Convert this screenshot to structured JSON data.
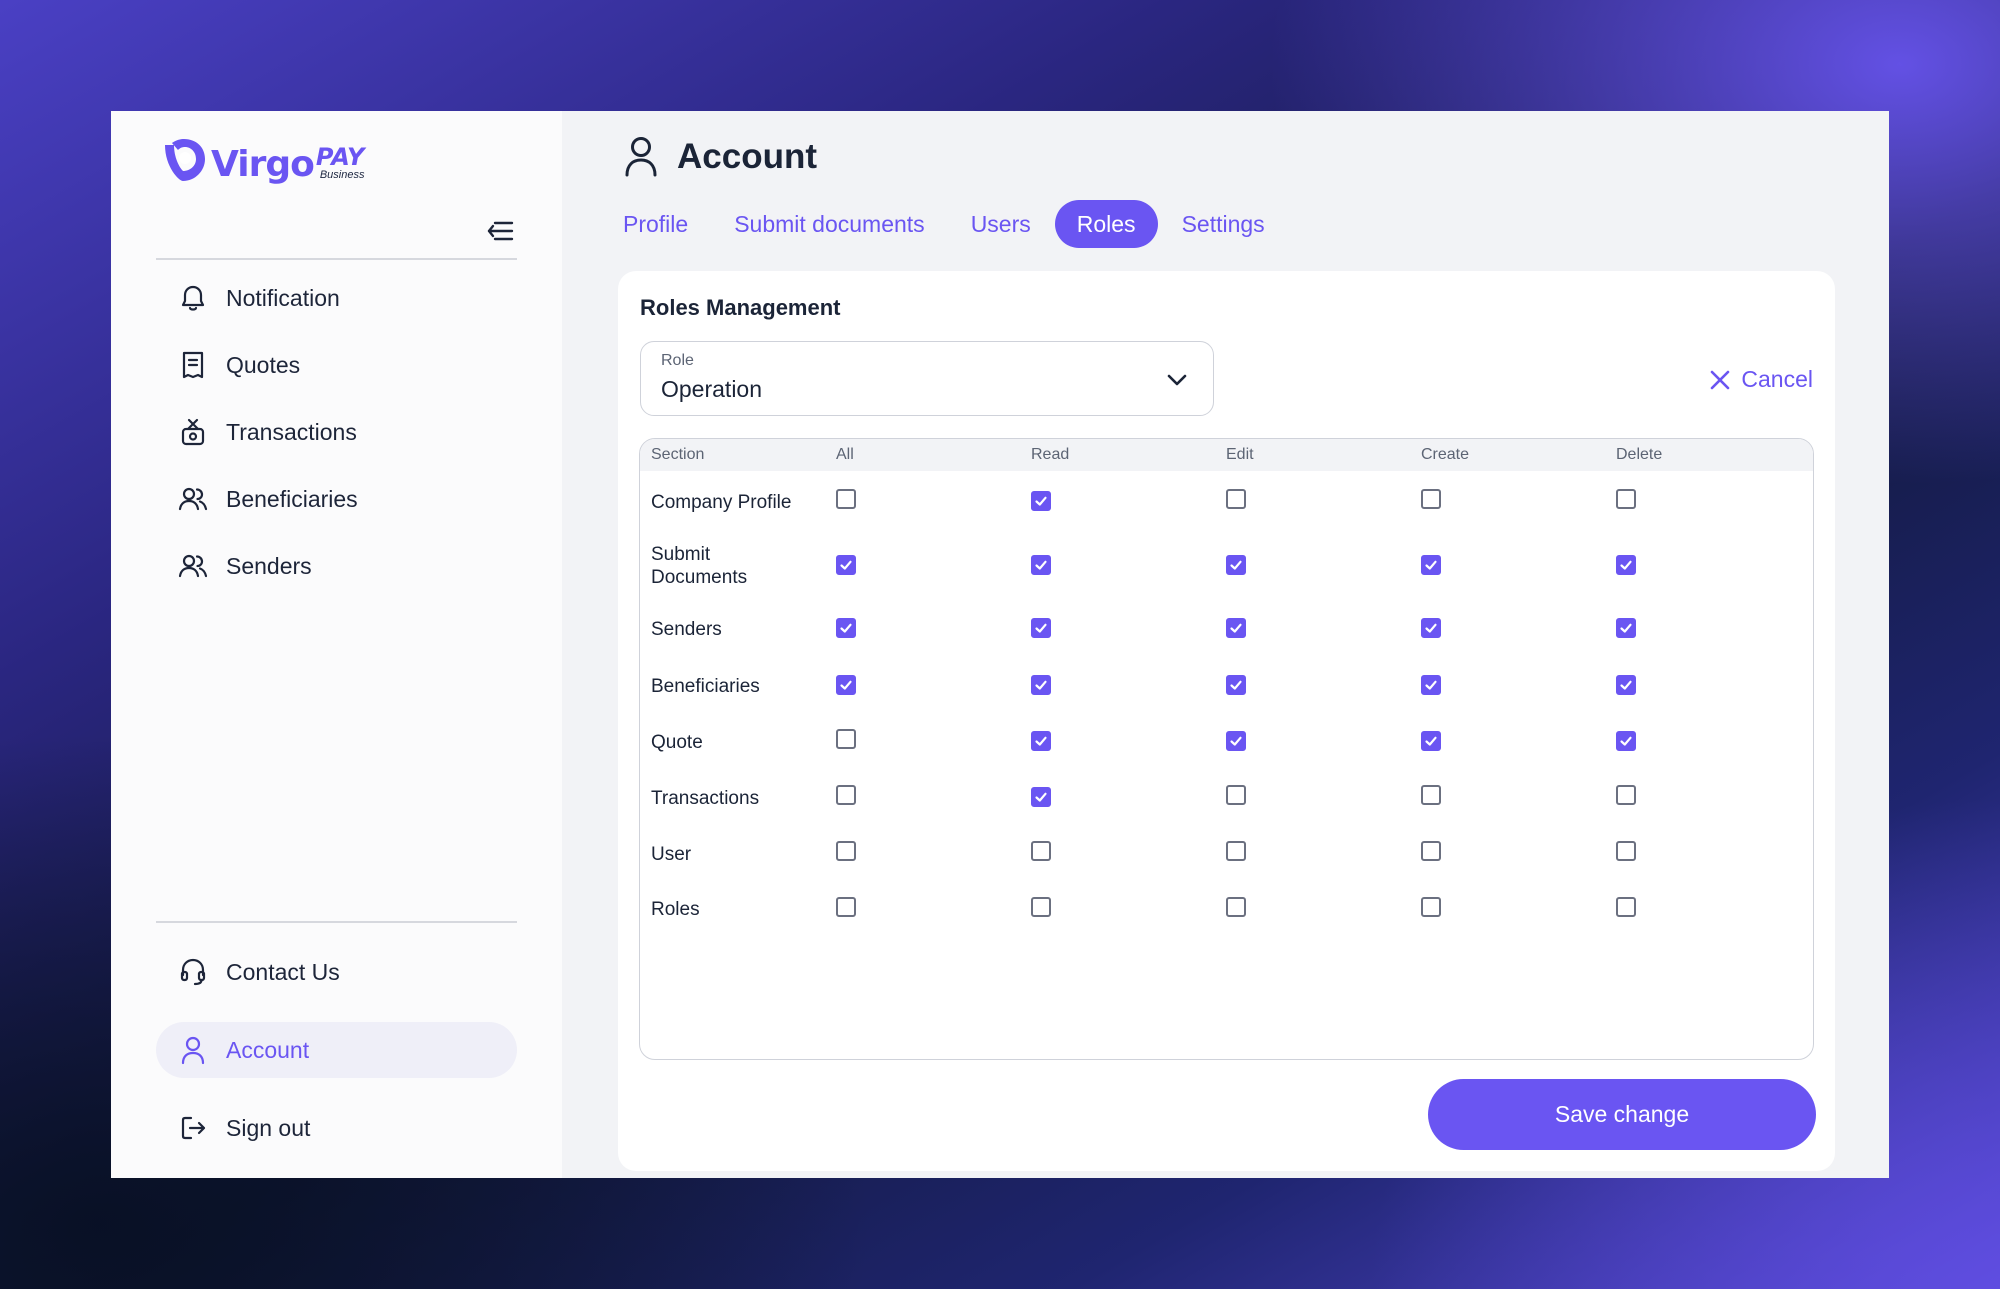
{
  "brand": {
    "name": "Virgo",
    "suffix": "PAY",
    "tagline": "Business",
    "color": "#6a55f2"
  },
  "sidebar": {
    "collapse_icon": "menu-collapse-icon",
    "items": [
      {
        "label": "Notification",
        "icon": "bell-icon"
      },
      {
        "label": "Quotes",
        "icon": "receipt-icon"
      },
      {
        "label": "Transactions",
        "icon": "money-bag-icon"
      },
      {
        "label": "Beneficiaries",
        "icon": "users-icon"
      },
      {
        "label": "Senders",
        "icon": "users-icon"
      }
    ],
    "bottom_items": [
      {
        "label": "Contact Us",
        "icon": "headset-icon",
        "active": false
      },
      {
        "label": "Account",
        "icon": "user-icon",
        "active": true
      },
      {
        "label": "Sign out",
        "icon": "sign-out-icon",
        "active": false
      }
    ]
  },
  "header": {
    "title": "Account",
    "icon": "user-icon"
  },
  "tabs": [
    {
      "label": "Profile",
      "active": false
    },
    {
      "label": "Submit documents",
      "active": false
    },
    {
      "label": "Users",
      "active": false
    },
    {
      "label": "Roles",
      "active": true
    },
    {
      "label": "Settings",
      "active": false
    }
  ],
  "roles": {
    "title": "Roles Management",
    "role_field": {
      "label": "Role",
      "value": "Operation"
    },
    "cancel_label": "Cancel",
    "columns": [
      "Section",
      "All",
      "Read",
      "Edit",
      "Create",
      "Delete"
    ],
    "rows": [
      {
        "section": "Company Profile",
        "all": false,
        "read": true,
        "edit": false,
        "create": false,
        "delete": false
      },
      {
        "section": "Submit Documents",
        "all": true,
        "read": true,
        "edit": true,
        "create": true,
        "delete": true
      },
      {
        "section": "Senders",
        "all": true,
        "read": true,
        "edit": true,
        "create": true,
        "delete": true
      },
      {
        "section": "Beneficiaries",
        "all": true,
        "read": true,
        "edit": true,
        "create": true,
        "delete": true
      },
      {
        "section": "Quote",
        "all": false,
        "read": true,
        "edit": true,
        "create": true,
        "delete": true
      },
      {
        "section": "Transactions",
        "all": false,
        "read": true,
        "edit": false,
        "create": false,
        "delete": false
      },
      {
        "section": "User",
        "all": false,
        "read": false,
        "edit": false,
        "create": false,
        "delete": false
      },
      {
        "section": "Roles",
        "all": false,
        "read": false,
        "edit": false,
        "create": false,
        "delete": false
      }
    ],
    "save_label": "Save change"
  }
}
